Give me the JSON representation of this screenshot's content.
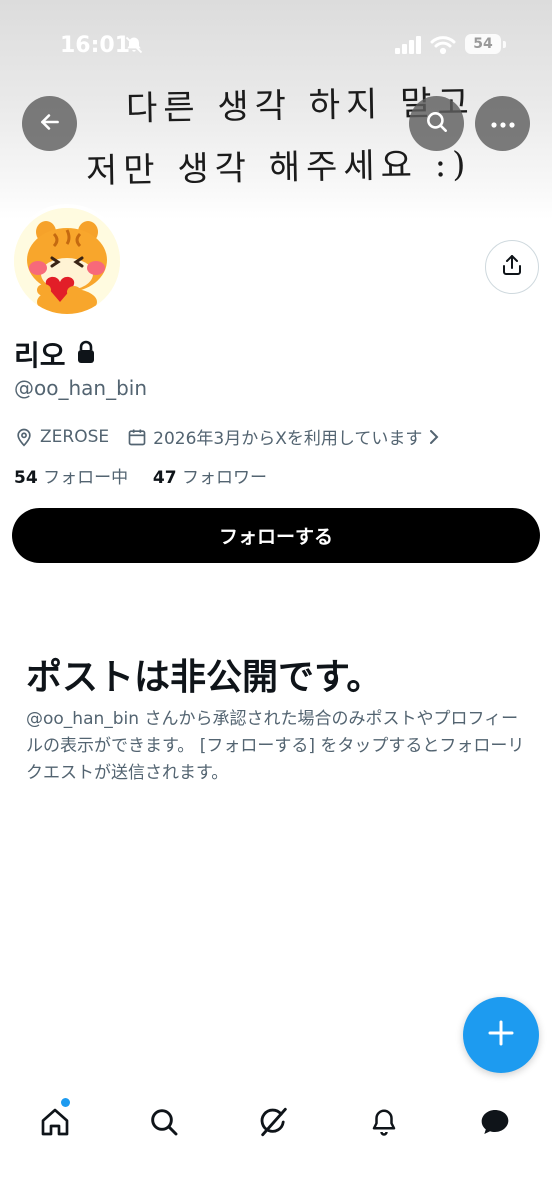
{
  "status_bar": {
    "time": "16:01",
    "battery": "54"
  },
  "banner": {
    "line1": "다른 생각 하지 말고",
    "line2": "저만 생각 해주세요 :)"
  },
  "profile": {
    "name": "리오",
    "handle": "@oo_han_bin",
    "location": "ZEROSE",
    "joined": "2026年3月からXを利用しています",
    "following_count": "54",
    "following_label": "フォロー中",
    "followers_count": "47",
    "followers_label": "フォロワー"
  },
  "follow_button": {
    "label": "フォローする"
  },
  "private_notice": {
    "title": "ポストは非公開です。",
    "description": "@oo_han_bin さんから承認された場合のみポストやプロフィールの表示ができます。 [フォローする] をタップするとフォローリクエストが送信されます。"
  },
  "icons": {
    "back": "arrow-left-icon",
    "search": "search-icon",
    "more": "more-horizontal-icon",
    "share": "share-icon",
    "lock": "lock-icon",
    "location": "location-pin-icon",
    "calendar": "calendar-icon",
    "compose": "plus-icon",
    "nav": [
      "home-icon",
      "search-icon",
      "grok-icon",
      "bell-icon",
      "message-icon"
    ]
  },
  "colors": {
    "accent": "#1d9bf0",
    "text": "#0f1419",
    "muted": "#536471",
    "button": "#000000"
  }
}
